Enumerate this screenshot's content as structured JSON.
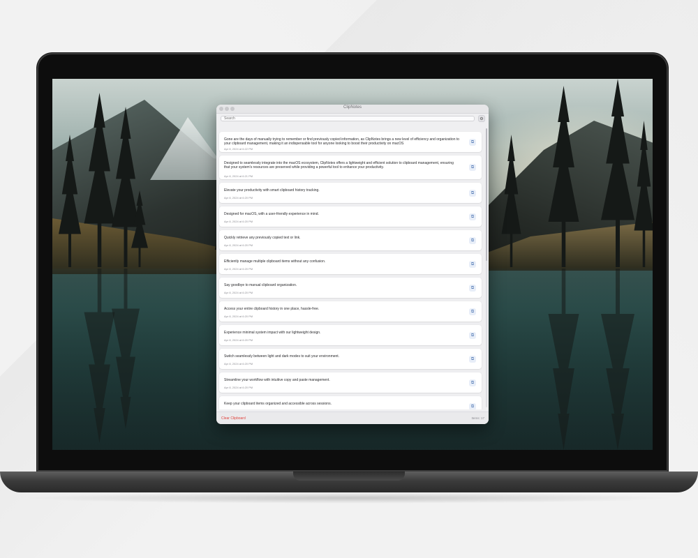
{
  "app": {
    "title": "ClipNotes"
  },
  "search": {
    "placeholder": "Search"
  },
  "settings_icon": "gear-icon",
  "items": [
    {
      "text": "Gone are the days of manually trying to remember or find previously copied information, as ClipNotes brings a new level of efficiency and organization to your clipboard management, making it an indispensable tool for anyone looking to boost their productivity on macOS",
      "date": "Apr 8, 2024 at 6:22 PM"
    },
    {
      "text": "Designed to seamlessly integrate into the macOS ecosystem, ClipNotes offers a lightweight and efficient solution to clipboard management, ensuring that your system's resources are preserved while providing a powerful tool to enhance your productivity.",
      "date": "Apr 8, 2024 at 6:21 PM"
    },
    {
      "text": "Elevate your productivity with smart clipboard history tracking.",
      "date": "Apr 8, 2024 at 6:20 PM"
    },
    {
      "text": "Designed for macOS, with a user-friendly experience in mind.",
      "date": "Apr 8, 2024 at 6:20 PM"
    },
    {
      "text": "Quickly retrieve any previously copied text or link.",
      "date": "Apr 8, 2024 at 6:20 PM"
    },
    {
      "text": "Efficiently manage multiple clipboard items without any confusion.",
      "date": "Apr 8, 2024 at 6:20 PM"
    },
    {
      "text": "Say goodbye to manual clipboard organization.",
      "date": "Apr 8, 2024 at 6:20 PM"
    },
    {
      "text": "Access your entire clipboard history in one place, hassle-free.",
      "date": "Apr 8, 2024 at 6:20 PM"
    },
    {
      "text": "Experience minimal system impact with our lightweight design.",
      "date": "Apr 8, 2024 at 6:20 PM"
    },
    {
      "text": "Switch seamlessly between light and dark modes to suit your environment.",
      "date": "Apr 8, 2024 at 6:20 PM"
    },
    {
      "text": "Streamline your workflow with intuitive copy and paste management.",
      "date": "Apr 8, 2024 at 6:20 PM"
    },
    {
      "text": "Keep your clipboard items organized and accessible across sessions.",
      "date": ""
    }
  ],
  "footer": {
    "clear_label": "Clear Clipboard",
    "count_label": "Items: 17"
  },
  "colors": {
    "clear": "#e0443e",
    "accent": "#5a7fb8"
  }
}
